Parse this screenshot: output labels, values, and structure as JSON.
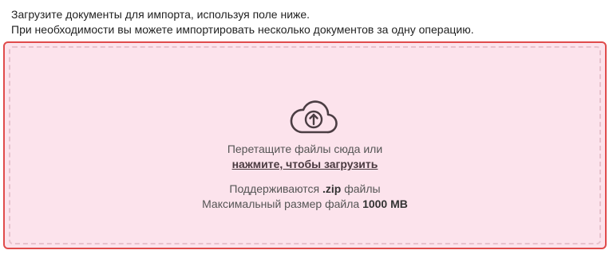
{
  "intro": {
    "line1": "Загрузите документы для импорта, используя поле ниже.",
    "line2": "При необходимости вы можете импортировать несколько документов за одну операцию."
  },
  "dropzone": {
    "icon": "cloud-upload-icon",
    "drag_text": "Перетащите файлы сюда или",
    "browse_link": "нажмите, чтобы загрузить",
    "supported_prefix": "Поддерживаются",
    "supported_format": ".zip",
    "supported_suffix": "файлы",
    "max_size_prefix": "Максимальный размер файла",
    "max_size_value": "1000 MB",
    "border_color": "#e04b4b",
    "background_color": "#fce3ec"
  }
}
